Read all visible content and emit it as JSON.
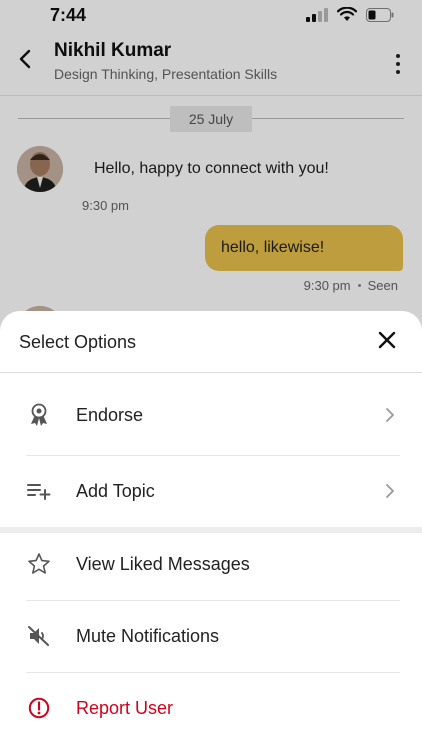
{
  "status_bar": {
    "time": "7:44",
    "icons": [
      "signal-icon",
      "wifi-icon",
      "battery-icon"
    ]
  },
  "header": {
    "name": "Nikhil Kumar",
    "subtitle": "Design Thinking, Presentation Skills",
    "icons": [
      "back-arrow-icon",
      "more-vertical-icon"
    ]
  },
  "chat": {
    "date": "25 July",
    "incoming": {
      "text": "Hello, happy to connect with you!",
      "time": "9:30 pm"
    },
    "outgoing": {
      "text": "hello, likewise!",
      "time": "9:30 pm",
      "status": "Seen"
    }
  },
  "sheet": {
    "title": "Select Options",
    "options": [
      {
        "label": "Endorse",
        "icon": "award-ribbon-icon",
        "chevron": true
      },
      {
        "label": "Add Topic",
        "icon": "playlist-add-icon",
        "chevron": true
      },
      {
        "label": "View Liked Messages",
        "icon": "star-icon",
        "chevron": false
      },
      {
        "label": "Mute Notifications",
        "icon": "volume-off-icon",
        "chevron": false
      },
      {
        "label": "Report User",
        "icon": "alert-circle-icon",
        "chevron": false
      }
    ]
  },
  "colors": {
    "outgoing_bubble": "#e8c04e",
    "report": "#d0021b",
    "overlay": "rgba(0,0,0,0.18)"
  }
}
